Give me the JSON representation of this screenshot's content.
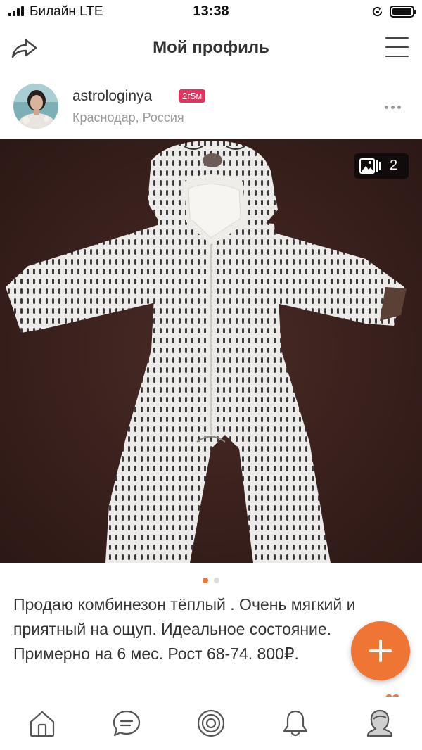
{
  "status_bar": {
    "carrier": "Билайн  LTE",
    "time": "13:38",
    "battery_level": 0.95
  },
  "header": {
    "title": "Мой профиль",
    "share_icon": "share-icon",
    "menu_icon": "hamburger-menu-icon"
  },
  "profile": {
    "username": "astrologinya",
    "badge": "2г5м",
    "location": "Краснодар, Россия",
    "more_icon": "more-dots-icon"
  },
  "photo": {
    "count": "2",
    "count_icon": "gallery-icon",
    "current_index": 1,
    "total": 2
  },
  "post": {
    "description": "Продаю комбинезон тёплый . Очень мягкий и приятный на ощуп. Идеальное состояние. Примерно на 6 мес. Рост 68-74. 800₽."
  },
  "fab": {
    "icon": "plus-icon"
  },
  "tab_bar": {
    "items": [
      {
        "name": "home",
        "icon": "home-icon"
      },
      {
        "name": "messages",
        "icon": "chat-icon"
      },
      {
        "name": "feed",
        "icon": "target-icon"
      },
      {
        "name": "notifications",
        "icon": "bell-icon"
      },
      {
        "name": "profile",
        "icon": "profile-icon"
      }
    ]
  },
  "colors": {
    "accent": "#ee7534",
    "badge": "#e4315e",
    "secondary_text": "#9a9a9a"
  }
}
